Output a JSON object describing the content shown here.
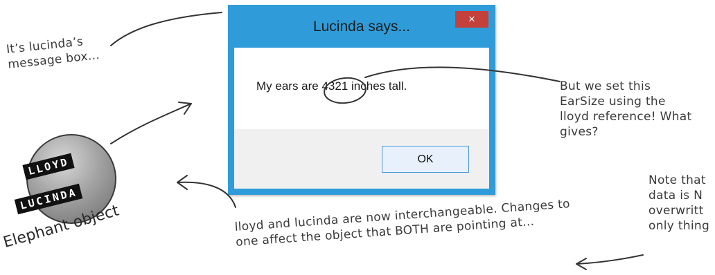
{
  "dialog": {
    "title": "Lucinda says...",
    "close_glyph": "×",
    "message": "My ears are 4321 inches tall.",
    "ok_label": "OK"
  },
  "annotations": {
    "top_left": "It’s lucinda’s\nmessage box...",
    "right": "But we set this\nEarSize using the\nlloyd reference! What\ngives?",
    "bottom_center": "lloyd and lucinda are now interchangeable. Changes to\none affect the object that BOTH are pointing at...",
    "bottom_right": "Note that\ndata is N\noverwritt\nonly thing"
  },
  "badge": {
    "lloyd": "LLOYD",
    "lucinda": "LUCINDA",
    "caption": "Elephant object"
  },
  "colors": {
    "window_frame": "#2f9cd9",
    "close_button": "#c4403a",
    "ok_border": "#4a97dc"
  }
}
